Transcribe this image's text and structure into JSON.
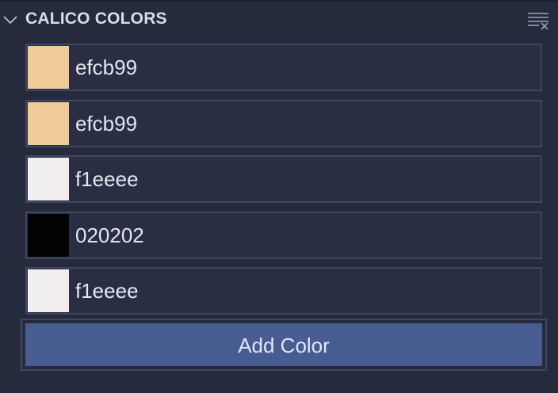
{
  "panel": {
    "title": "CALICO COLORS",
    "collapse_icon": "chevron-down-icon",
    "clear_icon": "clear-all-icon"
  },
  "colors": [
    {
      "hex": "efcb99",
      "swatch": "#efcb99"
    },
    {
      "hex": "efcb99",
      "swatch": "#efcb99"
    },
    {
      "hex": "f1eeee",
      "swatch": "#f1eeee"
    },
    {
      "hex": "020202",
      "swatch": "#020202"
    },
    {
      "hex": "f1eeee",
      "swatch": "#f1eeee"
    }
  ],
  "add_button": {
    "label": "Add Color",
    "color": "#475c91"
  }
}
